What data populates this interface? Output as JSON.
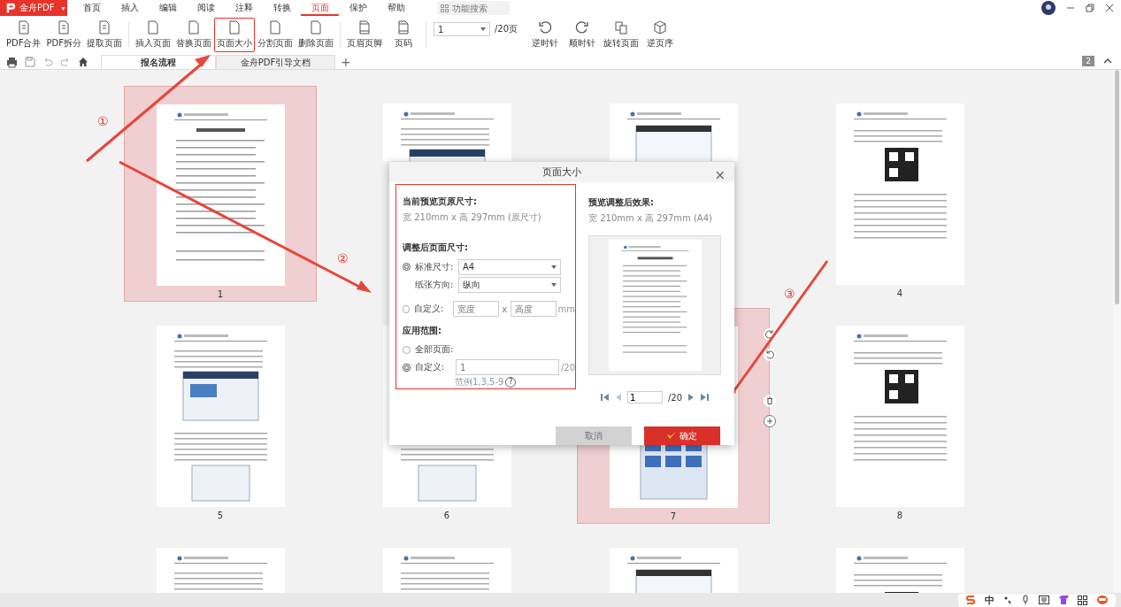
{
  "app": {
    "logo": "金舟PDF",
    "logo_caret": "▾"
  },
  "menu": [
    {
      "label": "首页",
      "selected": false
    },
    {
      "label": "插入",
      "selected": false
    },
    {
      "label": "编辑",
      "selected": false
    },
    {
      "label": "阅读",
      "selected": false
    },
    {
      "label": "注释",
      "selected": false
    },
    {
      "label": "转换",
      "selected": false
    },
    {
      "label": "页面",
      "selected": true
    },
    {
      "label": "保护",
      "selected": false
    },
    {
      "label": "帮助",
      "selected": false
    }
  ],
  "search": {
    "placeholder": "功能搜索"
  },
  "toolbar": {
    "groups": [
      [
        {
          "label": "PDF合并",
          "highlighted": false
        },
        {
          "label": "PDF拆分",
          "highlighted": false
        },
        {
          "label": "提取页面",
          "highlighted": false
        }
      ],
      [
        {
          "label": "插入页面",
          "highlighted": false
        },
        {
          "label": "替换页面",
          "highlighted": false
        },
        {
          "label": "页面大小",
          "highlighted": true
        },
        {
          "label": "分割页面",
          "highlighted": false
        },
        {
          "label": "删除页面",
          "highlighted": false
        }
      ],
      [
        {
          "label": "页眉页脚",
          "highlighted": false
        },
        {
          "label": "页码",
          "highlighted": false
        }
      ]
    ],
    "page_select": {
      "value": "1",
      "total": "/20页"
    },
    "rotate": [
      {
        "label": "逆时针"
      },
      {
        "label": "顺时针"
      },
      {
        "label": "旋转页面"
      },
      {
        "label": "逆页序"
      }
    ]
  },
  "tabs": [
    {
      "label": "报名流程",
      "selected": true
    },
    {
      "label": "金舟PDF引导文档",
      "selected": false
    }
  ],
  "new_tab": "+",
  "tab_count": "2",
  "pages": [
    [
      {
        "label": "1",
        "selected": true
      },
      {
        "selected": false,
        "covered": true
      },
      {
        "selected": false,
        "covered": true
      },
      {
        "label": "4",
        "selected": false
      }
    ],
    [
      {
        "label": "5",
        "selected": false
      },
      {
        "label": "6",
        "selected": false
      },
      {
        "label": "7",
        "selected": true
      },
      {
        "label": "8",
        "selected": false
      }
    ],
    [
      {
        "selected": false
      },
      {
        "selected": false
      },
      {
        "selected": false
      },
      {
        "selected": false
      }
    ]
  ],
  "annotations": [
    "①",
    "②",
    "③"
  ],
  "dialog": {
    "title": "页面大小",
    "close": "×",
    "current": {
      "heading": "当前预览页原尺寸:",
      "value": "宽 210mm x 高 297mm (原尺寸)"
    },
    "adjusted": {
      "heading": "调整后页面尺寸:",
      "standard": {
        "label": "标准尺寸:",
        "selected": true,
        "value": "A4"
      },
      "orientation": {
        "label": "纸张方向:",
        "value": "纵向"
      },
      "custom": {
        "label": "自定义:",
        "selected": false,
        "width_placeholder": "宽度",
        "times": "x",
        "height_placeholder": "高度",
        "unit": "mm"
      }
    },
    "range": {
      "heading": "应用范围:",
      "all": {
        "label": "全部页面:",
        "selected": false
      },
      "custom": {
        "label": "自定义:",
        "selected": true,
        "placeholder": "1",
        "total": "/20",
        "hint": "范例1,3,5-9",
        "help": "?"
      }
    },
    "preview": {
      "heading": "预览调整后效果:",
      "value": "宽 210mm x 高 297mm (A4)",
      "page": "1",
      "total": "/20"
    },
    "cancel": {
      "label": "取消",
      "disabled": true
    },
    "ok": {
      "label": "确定"
    }
  },
  "ime": {
    "language": "中"
  }
}
